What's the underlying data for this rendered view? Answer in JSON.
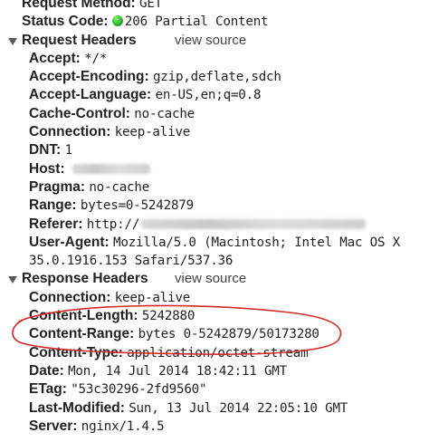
{
  "general": {
    "request_method": {
      "key": "Request Method:",
      "value": "GET"
    },
    "status_code": {
      "key": "Status Code:",
      "value": "206 Partial Content",
      "status_color": "#2fb52a"
    }
  },
  "request_headers": {
    "title": "Request Headers",
    "view_source": "view source",
    "items": [
      {
        "key": "Accept:",
        "value": "*/*"
      },
      {
        "key": "Accept-Encoding:",
        "value": "gzip,deflate,sdch"
      },
      {
        "key": "Accept-Language:",
        "value": "en-US,en;q=0.8"
      },
      {
        "key": "Cache-Control:",
        "value": "no-cache"
      },
      {
        "key": "Connection:",
        "value": "keep-alive"
      },
      {
        "key": "DNT:",
        "value": "1"
      },
      {
        "key": "Host:",
        "value": ""
      },
      {
        "key": "Pragma:",
        "value": "no-cache"
      },
      {
        "key": "Range:",
        "value": "bytes=0-5242879"
      },
      {
        "key": "Referer:",
        "value": "http://"
      },
      {
        "key": "User-Agent:",
        "value": "Mozilla/5.0 (Macintosh; Intel Mac OS X"
      },
      {
        "key": "",
        "value": "35.0.1916.153 Safari/537.36"
      }
    ]
  },
  "response_headers": {
    "title": "Response Headers",
    "view_source": "view source",
    "items": [
      {
        "key": "Connection:",
        "value": "keep-alive"
      },
      {
        "key": "Content-Length:",
        "value": "5242880"
      },
      {
        "key": "Content-Range:",
        "value": "bytes 0-5242879/50173280"
      },
      {
        "key": "Content-Type:",
        "value": "application/octet-stream"
      },
      {
        "key": "Date:",
        "value": "Mon, 14 Jul 2014 18:42:11 GMT"
      },
      {
        "key": "ETag:",
        "value": "\"53c30296-2fd9560\""
      },
      {
        "key": "Last-Modified:",
        "value": "Sun, 13 Jul 2014 22:05:10 GMT"
      },
      {
        "key": "Server:",
        "value": "nginx/1.4.5"
      }
    ]
  },
  "annotation_color": "#d42a2a"
}
